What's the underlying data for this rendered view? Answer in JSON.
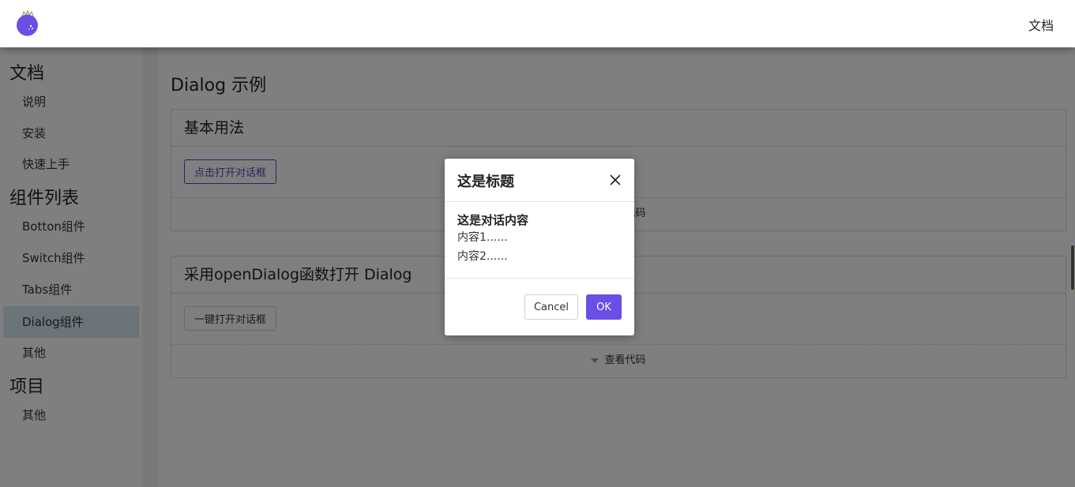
{
  "topnav": {
    "doc_link": "文档",
    "logo_icon": "purple-ball-crown-logo"
  },
  "sidebar": {
    "sections": [
      {
        "title": "文档",
        "items": [
          "说明",
          "安装",
          "快速上手"
        ]
      },
      {
        "title": "组件列表",
        "items": [
          "Botton组件",
          "Switch组件",
          "Tabs组件",
          "Dialog组件",
          "其他"
        ]
      },
      {
        "title": "项目",
        "items": [
          "其他"
        ]
      }
    ],
    "active_item": "Dialog组件"
  },
  "main": {
    "page_title": "Dialog 示例",
    "demos": [
      {
        "title": "基本用法",
        "button": "点击打开对话框",
        "code_toggle": "查看代码"
      },
      {
        "title": "采用openDialog函数打开 Dialog",
        "button": "一键打开对话框",
        "code_toggle": "查看代码"
      }
    ]
  },
  "dialog": {
    "title": "这是标题",
    "content_bold": "这是对话内容",
    "content_lines": [
      "内容1......",
      "内容2......"
    ],
    "cancel_label": "Cancel",
    "ok_label": "OK"
  },
  "colors": {
    "accent": "#6a4ee6",
    "active_item_bg": "#d7e9f3",
    "overlay": "rgba(0,0,0,0.5)"
  }
}
